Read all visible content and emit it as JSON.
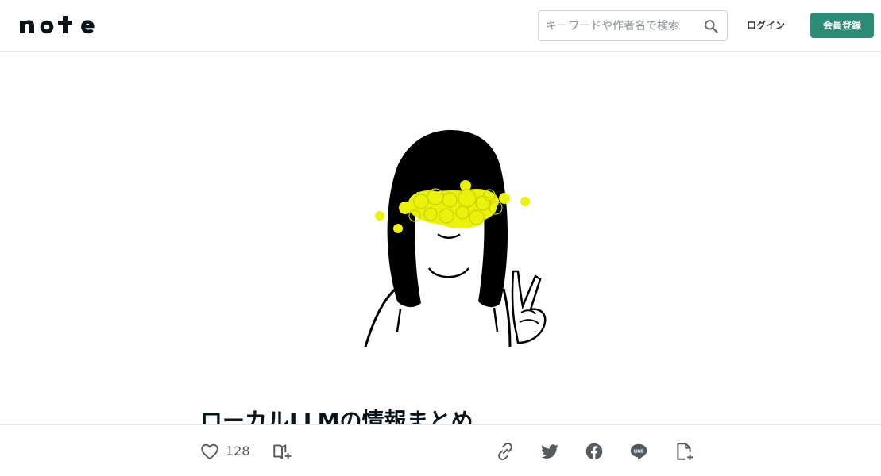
{
  "header": {
    "logo_text": "note",
    "search_placeholder": "キーワードや作者名で検索",
    "login_label": "ログイン",
    "signup_label": "会員登録",
    "brand_color": "#2a8c74"
  },
  "article": {
    "title": "ローカルLLMの情報まとめ",
    "hero_icon": "girl-peace-sign-illustration"
  },
  "actions": {
    "like_count": "128",
    "icons": [
      "heart-icon",
      "magazine-add-icon",
      "link-icon",
      "twitter-icon",
      "facebook-icon",
      "line-icon",
      "embed-icon"
    ]
  }
}
